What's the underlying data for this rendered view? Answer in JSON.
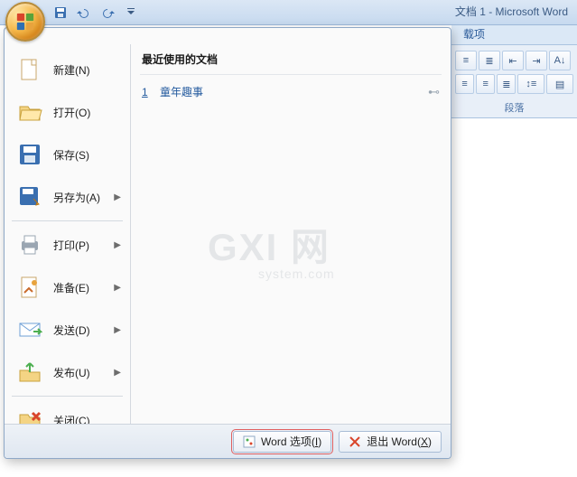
{
  "window": {
    "title": "文档 1 - Microsoft Word"
  },
  "ribbon": {
    "tab": "载项",
    "group_label": "段落"
  },
  "menu": {
    "items": [
      {
        "label": "新建(N)",
        "hotkey": "N",
        "arrow": false
      },
      {
        "label": "打开(O)",
        "hotkey": "O",
        "arrow": false
      },
      {
        "label": "保存(S)",
        "hotkey": "S",
        "arrow": false
      },
      {
        "label": "另存为(A)",
        "hotkey": "A",
        "arrow": true
      },
      {
        "label": "打印(P)",
        "hotkey": "P",
        "arrow": true
      },
      {
        "label": "准备(E)",
        "hotkey": "E",
        "arrow": true
      },
      {
        "label": "发送(D)",
        "hotkey": "D",
        "arrow": true
      },
      {
        "label": "发布(U)",
        "hotkey": "U",
        "arrow": true
      },
      {
        "label": "关闭(C)",
        "hotkey": "C",
        "arrow": false
      }
    ],
    "recent_header": "最近使用的文档",
    "recent": [
      {
        "num": "1",
        "name": "童年趣事"
      }
    ],
    "footer": {
      "options_prefix": "Word 选项(",
      "options_hot": "I",
      "options_suffix": ")",
      "exit_prefix": "退出 Word(",
      "exit_hot": "X",
      "exit_suffix": ")"
    }
  },
  "watermark": {
    "main": "GXI 网",
    "sub": "system.com"
  }
}
